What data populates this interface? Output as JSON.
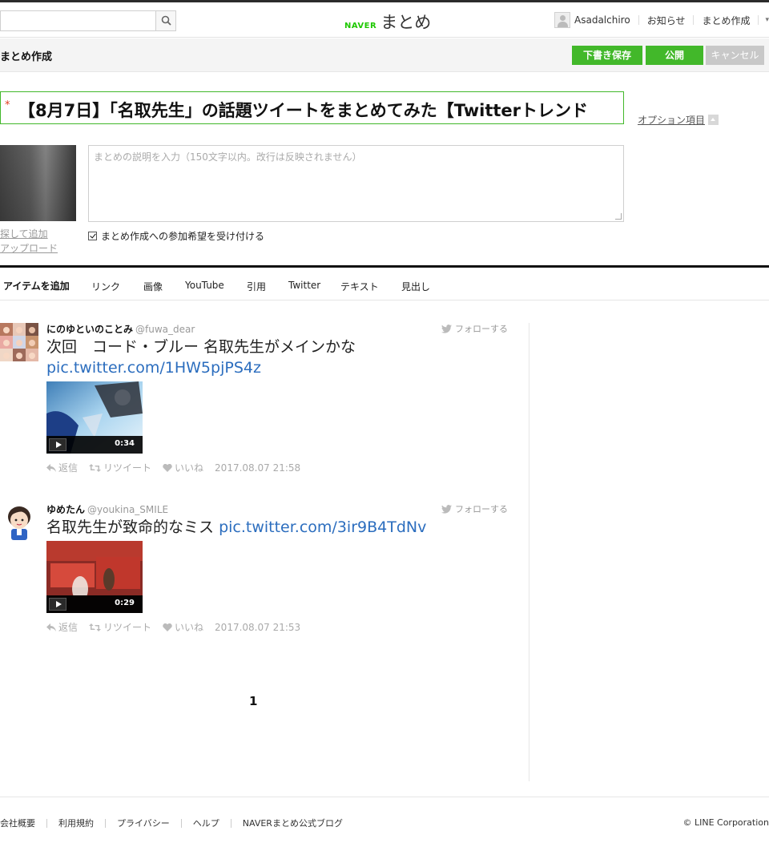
{
  "header": {
    "search_placeholder": "",
    "logo_brand": "NAVER",
    "logo_name": "まとめ",
    "username": "Asadalchiro",
    "nav_notice": "お知らせ",
    "nav_create": "まとめ作成",
    "caret": "▾"
  },
  "actionbar": {
    "title": "まとめ作成",
    "save_draft": "下書き保存",
    "publish": "公開",
    "cancel": "キャンセル"
  },
  "editor": {
    "required_mark": "*",
    "title_value": "【8月7日】「名取先生」の話題ツイートをまとめてみた【Twitterトレンド",
    "options_link": "オプション項目",
    "image_search": "探して追加",
    "image_upload": "アップロード",
    "description_placeholder": "まとめの説明を入力（150文字以内。改行は反映されません）",
    "accept_participation": "まとめ作成への参加希望を受け付ける"
  },
  "itembar": {
    "label": "アイテムを追加",
    "items": [
      "リンク",
      "画像",
      "YouTube",
      "引用",
      "Twitter",
      "テキスト",
      "見出し"
    ]
  },
  "tweets": [
    {
      "name": "にのゆといのことみ",
      "handle": "@fuwa_dear",
      "follow": "フォローする",
      "text": "次回　コード・ブルー 名取先生がメインかな",
      "link": "pic.twitter.com/1HW5pjPS4z",
      "duration": "0:34",
      "reply": "返信",
      "retweet": "リツイート",
      "like": "いいね",
      "date": "2017.08.07 21:58"
    },
    {
      "name": "ゆめたん",
      "handle": "@youkina_SMILE",
      "follow": "フォローする",
      "text": "名取先生が致命的なミス",
      "link": "pic.twitter.com/3ir9B4TdNv",
      "duration": "0:29",
      "reply": "返信",
      "retweet": "リツイート",
      "like": "いいね",
      "date": "2017.08.07 21:53"
    }
  ],
  "pager": {
    "current": "1"
  },
  "footer": {
    "links": [
      "会社概要",
      "利用規約",
      "プライバシー",
      "ヘルプ",
      "NAVERまとめ公式ブログ"
    ],
    "copyright": "© LINE Corporation"
  },
  "colors": {
    "accent_green": "#42b82a",
    "link_blue": "#2b6dbe",
    "brand_green": "#1ec800"
  }
}
